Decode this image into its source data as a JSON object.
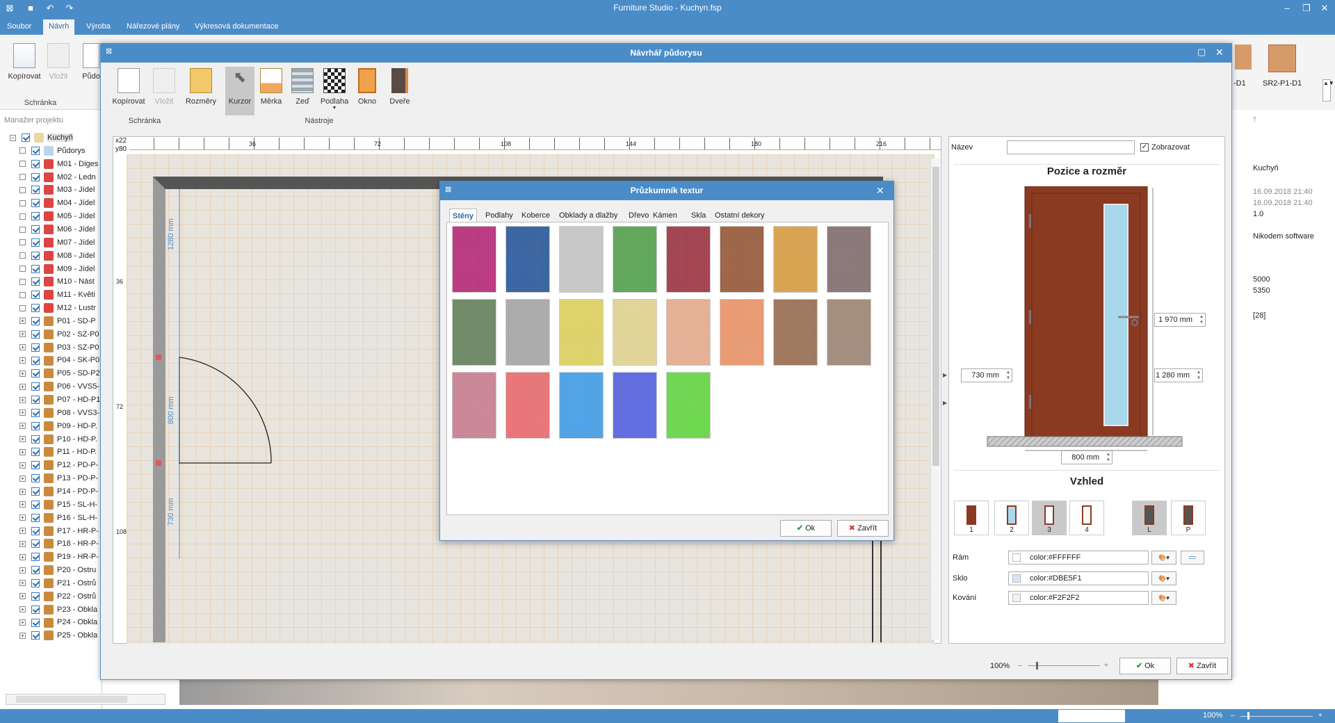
{
  "app": {
    "title": "Furniture Studio - Kuchyn.fsp"
  },
  "menu": [
    "Soubor",
    "Návrh",
    "Výroba",
    "Nářezové plány",
    "Výkresová dokumentace"
  ],
  "ribbon": {
    "copy": "Kopírovat",
    "paste": "Vložit",
    "floor": "Půdo",
    "group": "Schránka"
  },
  "outer_right": {
    "items": [
      {
        "label": "-D1"
      },
      {
        "label": "SR2-P1-D1"
      }
    ],
    "name": "Kuchyň",
    "date1": "16.09.2018 21:40",
    "date2": "16.09.2018 21:40",
    "version": "1.0",
    "company": "Nikodem software",
    "v1": "5000",
    "v2": "5350",
    "v3": "[28]",
    "zoom": "100%"
  },
  "project": {
    "title": "Manažer projektu",
    "items": [
      "Kuchyň",
      "Půdorys",
      "M01 - Diges",
      "M02 - Ledn",
      "M03 - Jídel",
      "M04 - Jídel",
      "M05 - Jídel",
      "M06 - Jídel",
      "M07 - Jídel",
      "M08 - Jídel",
      "M09 - Jídel",
      "M10 - Nást",
      "M11 - Květi",
      "M12 - Lustr",
      "P01 - SD-P",
      "P02 - SZ-P0",
      "P03 - SZ-P0",
      "P04 - SK-P0",
      "P05 - SD-P2",
      "P06 - VVS5-",
      "P07 - HD-P1",
      "P08 - VVS3-",
      "P09 - HD-P.",
      "P10 - HD-P.",
      "P11 - HD-P.",
      "P12 - PD-P-",
      "P13 - PD-P-",
      "P14 - PD-P-",
      "P15 - SL-H-",
      "P16 - SL-H-",
      "P17 - HR-P-",
      "P18 - HR-P-",
      "P19 - HR-P-",
      "P20 - Ostru",
      "P21 - Ostrů",
      "P22 - Ostrů",
      "P23 - Obkla",
      "P24 - Obkla",
      "P25 - Obkla"
    ]
  },
  "dialog": {
    "title": "Návrhář půdorysu",
    "tools": {
      "copy": "Kopírovat",
      "paste": "Vložit",
      "dims": "Rozměry",
      "cursor": "Kurzor",
      "scale": "Měrka",
      "wall": "Zeď",
      "floor": "Podlaha",
      "window": "Okno",
      "door": "Dveře"
    },
    "groups": {
      "clipboard": "Schránka",
      "tools": "Nástroje"
    },
    "ruler": {
      "corner_x": "x22",
      "corner_y": "y80",
      "top": [
        "36",
        "72",
        "108",
        "144",
        "180",
        "216"
      ],
      "left": [
        "36",
        "72",
        "108"
      ]
    },
    "dims": {
      "d1": "1280 mm",
      "d2": "800 mm",
      "d3": "730 mm"
    },
    "zoom": "100%",
    "ok": "Ok",
    "close": "Zavřít"
  },
  "texture": {
    "title": "Průzkumník textur",
    "tabs": [
      "Stěny",
      "Podlahy",
      "Koberce",
      "Obklady a dlažby",
      "Dřevo",
      "Kámen",
      "Skla",
      "Ostatní dekory"
    ],
    "swatches": [
      "#b8347e",
      "#33609e",
      "#c5c5c5",
      "#5ca456",
      "#a13e4c",
      "#9a6042",
      "#d7a04c",
      "#877475",
      "#6b8763",
      "#a8a8a8",
      "#ddd067",
      "#e0d394",
      "#e4ae91",
      "#e8976e",
      "#9b7359",
      "#a08a7a",
      "#c98394",
      "#e77174",
      "#4aa0e4",
      "#5c69de",
      "#6ad64a"
    ],
    "ok": "Ok",
    "close": "Zavřít"
  },
  "props": {
    "name_label": "Název",
    "show_label": "Zobrazovat",
    "pos_title": "Pozice a rozměr",
    "h": "1 970 mm",
    "w_left": "730 mm",
    "h2": "1 280 mm",
    "width": "800 mm",
    "look_title": "Vzhled",
    "looks": [
      "1",
      "2",
      "3",
      "4",
      "L",
      "P"
    ],
    "frame_label": "Rám",
    "frame_val": "color:#FFFFFF",
    "glass_label": "Sklo",
    "glass_val": "color:#DBE5F1",
    "hw_label": "Kování",
    "hw_val": "color:#F2F2F2",
    "colors": {
      "frame": "#FFFFFF",
      "glass": "#DBE5F1",
      "hw": "#F2F2F2",
      "door": "#8b3a22"
    }
  }
}
